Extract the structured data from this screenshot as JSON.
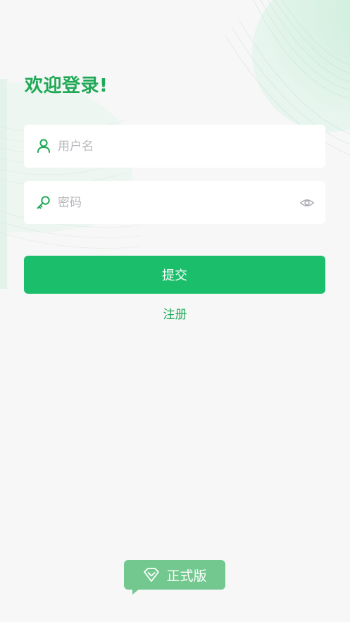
{
  "header": {
    "title": "欢迎登录!"
  },
  "form": {
    "username": {
      "placeholder": "用户名",
      "value": "",
      "icon": "user-icon"
    },
    "password": {
      "placeholder": "密码",
      "value": "",
      "icon": "key-icon",
      "toggle_icon": "eye-icon"
    },
    "submit_label": "提交",
    "register_label": "注册"
  },
  "footer": {
    "badge_label": "正式版",
    "badge_icon": "diamond-icon"
  },
  "colors": {
    "accent": "#1abe6b",
    "title": "#1fa957",
    "badge": "#72c88e",
    "background": "#f7f7f7"
  }
}
